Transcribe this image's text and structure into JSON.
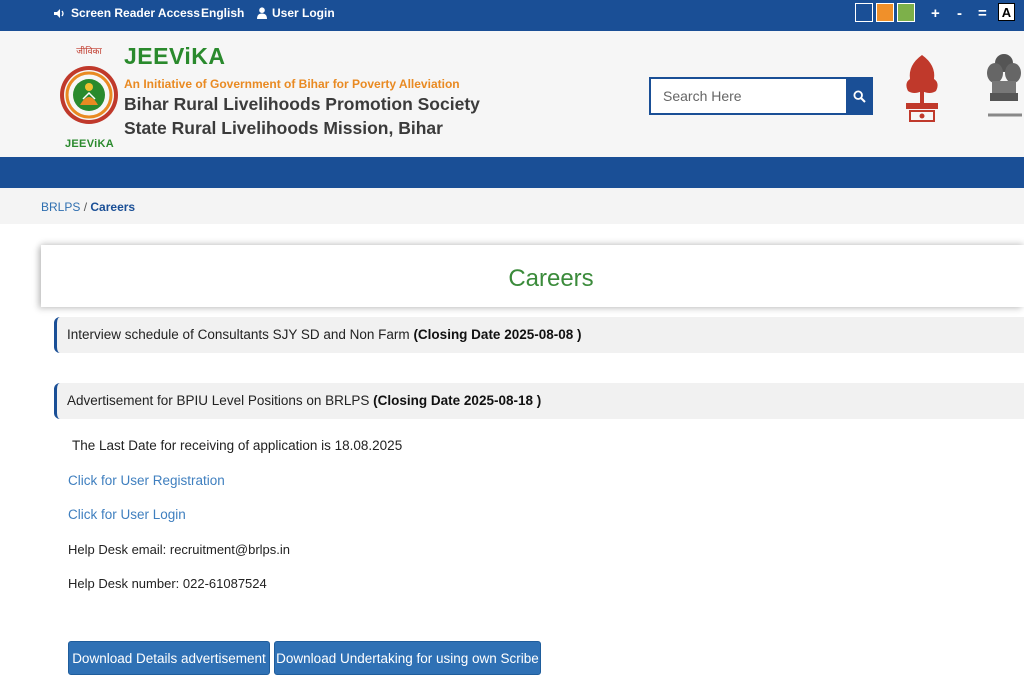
{
  "topbar": {
    "screen_reader": "Screen Reader Access",
    "language": "English",
    "login": "User Login",
    "theme_colors": [
      "#1a4f96",
      "#f0902a",
      "#7db04a"
    ],
    "font_increase": "+",
    "font_decrease": "-",
    "font_reset": "=",
    "contrast": "A"
  },
  "header": {
    "logo_caption": "JEEViKA",
    "brand": "JEEViKA",
    "tagline": "An Initiative of Government of Bihar for Poverty Alleviation",
    "org_line1": "Bihar Rural Livelihoods Promotion Society",
    "org_line2": "State Rural Livelihoods Mission, Bihar",
    "brand_color": "#2a8a2d",
    "tagline_color": "#e98a22"
  },
  "search": {
    "placeholder": "Search Here",
    "icon": "search-icon"
  },
  "breadcrumb": {
    "home": "BRLPS",
    "separator": "/",
    "current": "Careers"
  },
  "page": {
    "title": "Careers"
  },
  "listings": [
    {
      "title": "Interview schedule of Consultants SJY SD and Non Farm",
      "closing": "(Closing Date 2025-08-08 )"
    },
    {
      "title": "Advertisement for BPIU Level Positions on BRLPS",
      "closing": "(Closing Date 2025-08-18 )"
    }
  ],
  "details": {
    "last_date": "The Last Date for receiving of application is 18.08.2025",
    "registration_link": "Click for User Registration",
    "login_link": "Click for User Login",
    "helpdesk_email": "Help Desk email: recruitment@brlps.in",
    "helpdesk_number": "Help Desk number: 022-61087524"
  },
  "buttons": {
    "download_advertisement": "Download Details advertisement",
    "download_undertaking": "Download Undertaking for using own Scribe"
  },
  "colors": {
    "primary": "#1a4f96",
    "link": "#3f7fbf",
    "title_green": "#3b8b3b",
    "button": "#2f71b5"
  }
}
